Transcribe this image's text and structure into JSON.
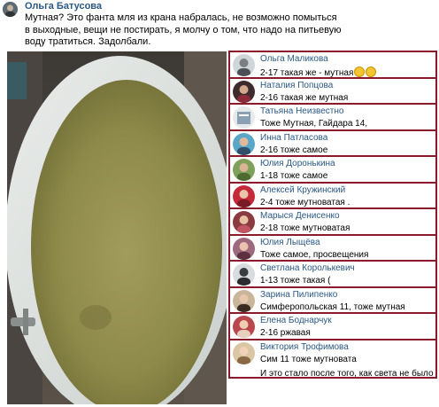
{
  "post": {
    "author": "Ольга Батусова",
    "text": "Мутная? Это фанта мля из крана набралась, не возможно помыться в выходные, вещи не постирать, я молчу о том, что надо на питьевую воду тратиться. Задолбали."
  },
  "comments": [
    {
      "name": "Ольга Маликова",
      "text": "2-17 такая же - мутная",
      "emoji": [
        "confused-face-icon",
        "astonished-face-icon"
      ]
    },
    {
      "name": "Наталия Попцова",
      "text": "2-16 такая же мутная"
    },
    {
      "name": "Татьяна Неизвестно",
      "text": "Тоже Мутная, Гайдара 14,"
    },
    {
      "name": "Инна Патласова",
      "text": "2-16 тоже самое"
    },
    {
      "name": "Юлия Доронькина",
      "text": "1-18 тоже самое"
    },
    {
      "name": "Алексей Кружинский",
      "text": "2-4 тоже мутноватая ."
    },
    {
      "name": "Марыся Денисенко",
      "text": "2-18 тоже мутноватая"
    },
    {
      "name": "Юлия Лыщёва",
      "text": "Тоже самое, просвещения"
    },
    {
      "name": "Светлана Королькевич",
      "text": "1-13 тоже такая ("
    },
    {
      "name": "Зарина Пилипенко",
      "text": "Симферопольская 11, тоже мутная"
    },
    {
      "name": "Елена Боднарчук",
      "text": "2-16 ржавая"
    },
    {
      "name": "Виктория Трофимова",
      "text": "Сим 11 тоже мутновата",
      "text2": "И это стало после того, как света не было"
    }
  ],
  "colors": {
    "link": "#2a5885",
    "frame": "#8b1a2b",
    "water": "#8f8b4a"
  }
}
